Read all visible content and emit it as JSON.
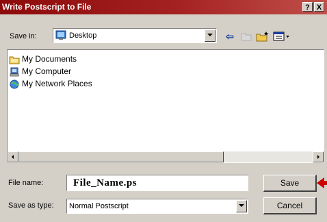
{
  "window": {
    "title": "Write Postscript to File",
    "help_label": "?",
    "close_label": "X"
  },
  "save_in": {
    "label": "Save in:",
    "value": "Desktop"
  },
  "toolbar": {
    "back_glyph": "⇦"
  },
  "files": [
    {
      "name": "My Documents",
      "icon": "folder-icon"
    },
    {
      "name": "My Computer",
      "icon": "computer-icon"
    },
    {
      "name": "My Network Places",
      "icon": "network-icon"
    }
  ],
  "file_name": {
    "label": "File name:",
    "value": "File_Name.ps"
  },
  "save_as_type": {
    "label": "Save as type:",
    "value": "Normal Postscript"
  },
  "buttons": {
    "save": "Save",
    "cancel": "Cancel"
  },
  "colors": {
    "title_start": "#8c0a0a",
    "title_end": "#c0504a",
    "arrow": "#cc0000",
    "dialog_bg": "#d4d0c8"
  }
}
